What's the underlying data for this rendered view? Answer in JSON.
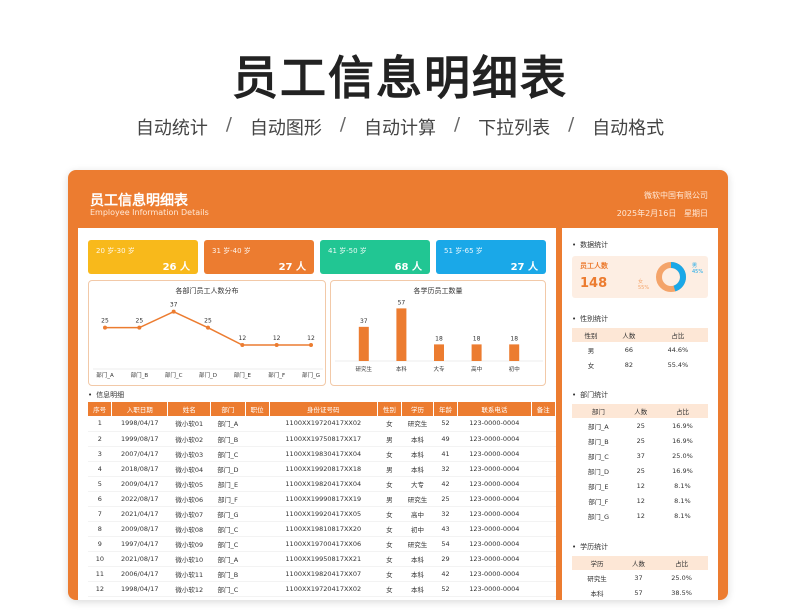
{
  "title": "员工信息明细表",
  "subtitle": [
    "自动统计",
    "自动图形",
    "自动计算",
    "下拉列表",
    "自动格式"
  ],
  "separator": "/",
  "card": {
    "title": "员工信息明细表",
    "title_en": "Employee Information Details",
    "company": "微软中国有限公司",
    "date": "2025年2月16日",
    "weekday": "星期日"
  },
  "age_groups": [
    {
      "label": "20 岁-30 岁",
      "value": "26 人",
      "color": "#f8b91b"
    },
    {
      "label": "31 岁-40 岁",
      "value": "27 人",
      "color": "#ec7c30"
    },
    {
      "label": "41 岁-50 岁",
      "value": "68 人",
      "color": "#21c693"
    },
    {
      "label": "51 岁-65 岁",
      "value": "27 人",
      "color": "#1aa8e8"
    }
  ],
  "chart_data": [
    {
      "type": "line",
      "title": "各部门员工人数分布",
      "categories": [
        "部门_A",
        "部门_B",
        "部门_C",
        "部门_D",
        "部门_E",
        "部门_F",
        "部门_G"
      ],
      "values": [
        25,
        25,
        37,
        25,
        12,
        12,
        12
      ],
      "ylim": [
        0,
        45
      ],
      "grid": false,
      "color": "#ec7c30"
    },
    {
      "type": "bar",
      "title": "各学历员工数量",
      "categories": [
        "研究生",
        "本科",
        "大专",
        "高中",
        "初中"
      ],
      "values": [
        37,
        57,
        18,
        18,
        18
      ],
      "ylim": [
        0,
        65
      ],
      "grid": false,
      "color": "#ec7c30"
    }
  ],
  "table_section_title": "信息明细",
  "table": {
    "headers": [
      "序号",
      "入职日期",
      "姓名",
      "部门",
      "职位",
      "身份证号码",
      "性别",
      "学历",
      "年龄",
      "联系电话",
      "备注"
    ],
    "rows": [
      [
        "1",
        "1998/04/17",
        "微小软01",
        "部门_A",
        "",
        "1100XX19720417XX02",
        "女",
        "研究生",
        "52",
        "123-0000-0004",
        ""
      ],
      [
        "2",
        "1999/08/17",
        "微小软02",
        "部门_B",
        "",
        "1100XX19750817XX17",
        "男",
        "本科",
        "49",
        "123-0000-0004",
        ""
      ],
      [
        "3",
        "2007/04/17",
        "微小软03",
        "部门_C",
        "",
        "1100XX19830417XX04",
        "女",
        "本科",
        "41",
        "123-0000-0004",
        ""
      ],
      [
        "4",
        "2018/08/17",
        "微小软04",
        "部门_D",
        "",
        "1100XX19920817XX18",
        "男",
        "本科",
        "32",
        "123-0000-0004",
        ""
      ],
      [
        "5",
        "2009/04/17",
        "微小软05",
        "部门_E",
        "",
        "1100XX19820417XX04",
        "女",
        "大专",
        "42",
        "123-0000-0004",
        ""
      ],
      [
        "6",
        "2022/08/17",
        "微小软06",
        "部门_F",
        "",
        "1100XX19990817XX19",
        "男",
        "研究生",
        "25",
        "123-0000-0004",
        ""
      ],
      [
        "7",
        "2021/04/17",
        "微小软07",
        "部门_G",
        "",
        "1100XX19920417XX05",
        "女",
        "高中",
        "32",
        "123-0000-0004",
        ""
      ],
      [
        "8",
        "2009/08/17",
        "微小软08",
        "部门_C",
        "",
        "1100XX19810817XX20",
        "女",
        "初中",
        "43",
        "123-0000-0004",
        ""
      ],
      [
        "9",
        "1997/04/17",
        "微小软09",
        "部门_C",
        "",
        "1100XX19700417XX06",
        "女",
        "研究生",
        "54",
        "123-0000-0004",
        ""
      ],
      [
        "10",
        "2021/08/17",
        "微小软10",
        "部门_A",
        "",
        "1100XX19950817XX21",
        "女",
        "本科",
        "29",
        "123-0000-0004",
        ""
      ],
      [
        "11",
        "2006/04/17",
        "微小软11",
        "部门_B",
        "",
        "1100XX19820417XX07",
        "女",
        "本科",
        "42",
        "123-0000-0004",
        ""
      ],
      [
        "12",
        "1998/04/17",
        "微小软12",
        "部门_C",
        "",
        "1100XX19720417XX02",
        "女",
        "本科",
        "52",
        "123-0000-0004",
        ""
      ]
    ]
  },
  "side": {
    "data_title": "数据统计",
    "total_label": "员工人数",
    "total_value": "148",
    "donut": {
      "male_label": "男",
      "male_pct": "45%",
      "male_value": 45,
      "female_label": "女",
      "female_pct": "55%",
      "female_value": 55,
      "male_color": "#1aa8e8",
      "female_color": "#f4a46a"
    },
    "gender_title": "性别统计",
    "gender_headers": [
      "性别",
      "人数",
      "占比"
    ],
    "gender_rows": [
      [
        "男",
        "66",
        "44.6%"
      ],
      [
        "女",
        "82",
        "55.4%"
      ]
    ],
    "dept_title": "部门统计",
    "dept_headers": [
      "部门",
      "人数",
      "占比"
    ],
    "dept_rows": [
      [
        "部门_A",
        "25",
        "16.9%"
      ],
      [
        "部门_B",
        "25",
        "16.9%"
      ],
      [
        "部门_C",
        "37",
        "25.0%"
      ],
      [
        "部门_D",
        "25",
        "16.9%"
      ],
      [
        "部门_E",
        "12",
        "8.1%"
      ],
      [
        "部门_F",
        "12",
        "8.1%"
      ],
      [
        "部门_G",
        "12",
        "8.1%"
      ]
    ],
    "edu_title": "学历统计",
    "edu_headers": [
      "学历",
      "人数",
      "占比"
    ],
    "edu_rows": [
      [
        "研究生",
        "37",
        "25.0%"
      ],
      [
        "本科",
        "57",
        "38.5%"
      ]
    ]
  },
  "colors": {
    "accent": "#ec7c30",
    "header_bg": "#fde7d6"
  }
}
